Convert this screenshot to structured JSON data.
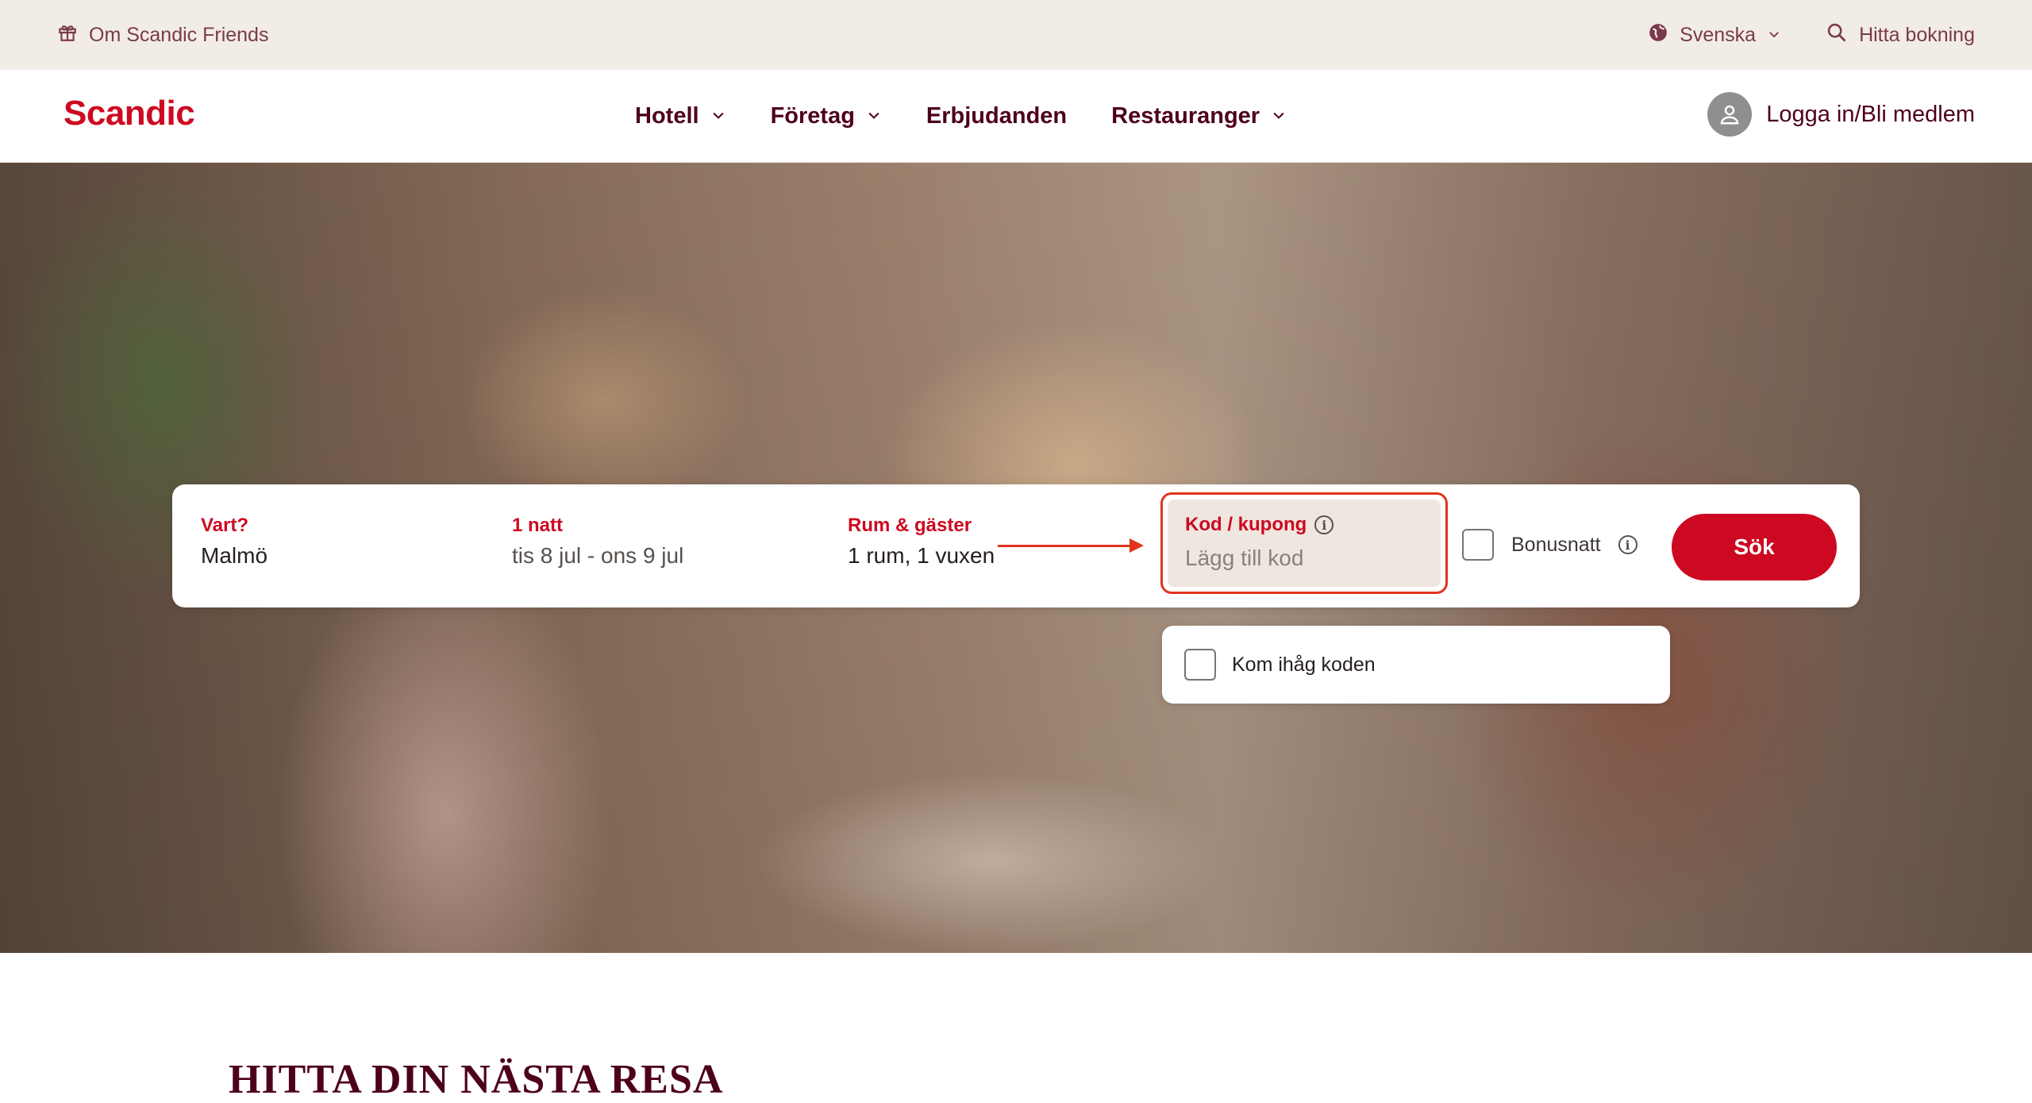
{
  "topbar": {
    "friends_label": "Om Scandic Friends",
    "language_label": "Svenska",
    "find_booking_label": "Hitta bokning"
  },
  "nav": {
    "logo": "Scandic",
    "links": [
      "Hotell",
      "Företag",
      "Erbjudanden",
      "Restauranger"
    ],
    "login_label": "Logga in/Bli medlem"
  },
  "booking": {
    "destination": {
      "label": "Vart?",
      "value": "Malmö"
    },
    "dates": {
      "label": "1 natt",
      "value": "tis 8 jul - ons 9 jul"
    },
    "rooms": {
      "label": "Rum & gäster",
      "value": "1 rum, 1 vuxen"
    },
    "code": {
      "label": "Kod / kupong",
      "placeholder": "Lägg till kod"
    },
    "bonus_label": "Bonusnatt",
    "search_label": "Sök",
    "remember_label": "Kom ihåg koden"
  },
  "section": {
    "title": "HITTA DIN NÄSTA RESA"
  },
  "colors": {
    "brand_red": "#cd0921",
    "annotation": "#e0351e",
    "topbar_bg": "#f2ece6"
  }
}
